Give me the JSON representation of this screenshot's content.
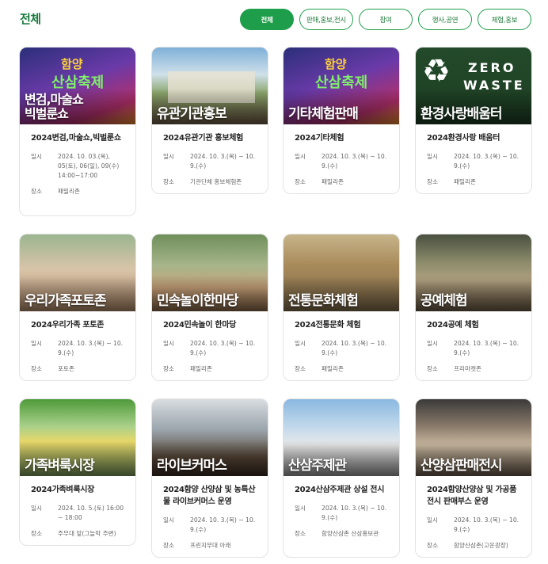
{
  "page": {
    "title": "전체"
  },
  "filters": [
    {
      "label": "전체",
      "active": true
    },
    {
      "label": "판매,홍보,전시",
      "active": false
    },
    {
      "label": "참여",
      "active": false
    },
    {
      "label": "행사,공연",
      "active": false
    },
    {
      "label": "체험,홍보",
      "active": false
    }
  ],
  "labels": {
    "date": "일시",
    "place": "장소"
  },
  "posters": {
    "festival_word_1": "함양",
    "festival_word_2": "산삼축제",
    "zero": "ZERO",
    "waste": "WASTE"
  },
  "cards": [
    {
      "overlay": "변검,마술쇼 빅벌룬쇼",
      "title": "2024변검,마술쇼,빅벌룬쇼",
      "date": "2024. 10. 03.(목), 05(토), 06(일), 09(수) 14:00~17:00",
      "place": "패밀리존"
    },
    {
      "overlay": "유관기관홍보",
      "title": "2024유관기관 홍보체험",
      "date": "2024. 10. 3.(목) ~ 10. 9.(수)",
      "place": "기관단체 홍보체험존"
    },
    {
      "overlay": "기타체험판매",
      "title": "2024기타체험",
      "date": "2024. 10. 3.(목) ~ 10. 9.(수)",
      "place": "패밀리존"
    },
    {
      "overlay": "환경사랑배움터",
      "title": "2024환경사랑 배움터",
      "date": "2024. 10. 3.(목) ~ 10. 9.(수)",
      "place": "패밀리존"
    },
    {
      "overlay": "우리가족포토존",
      "title": "2024우리가족 포토존",
      "date": "2024. 10. 3.(목) ~ 10. 9.(수)",
      "place": "포토존"
    },
    {
      "overlay": "민속놀이한마당",
      "title": "2024민속놀이 한마당",
      "date": "2024. 10. 3.(목) ~ 10. 9.(수)",
      "place": "패밀리존"
    },
    {
      "overlay": "전통문화체험",
      "title": "2024전통문화 체험",
      "date": "2024. 10. 3.(목) ~ 10. 9.(수)",
      "place": "패밀리존"
    },
    {
      "overlay": "공예체험",
      "title": "2024공예 체험",
      "date": "2024. 10. 3.(목) ~ 10. 9.(수)",
      "place": "프리마켓존"
    },
    {
      "overlay": "가족벼룩시장",
      "title": "2024가족벼룩시장",
      "date": "2024. 10. 5.(토) 16:00 ~ 18:00",
      "place": "주무대 앞(그늘막 주변)"
    },
    {
      "overlay": "라이브커머스",
      "title": "2024함양 산양삼 및 농특산물 라이브커머스 운영",
      "date": "2024. 10. 3.(목) ~ 10. 9.(수)",
      "place": "프린지무대 아래"
    },
    {
      "overlay": "산삼주제관",
      "title": "2024산삼주제관 상설 전시",
      "date": "2024. 10. 3.(목) ~ 10. 9.(수)",
      "place": "함양산삼촌 산삼홍보관"
    },
    {
      "overlay": "산양삼판매전시",
      "title": "2024함양산양삼 및 가공품 전시 판매부스 운영",
      "date": "2024. 10. 3.(목) ~ 10. 9.(수)",
      "place": "함양산삼촌(고운광장)"
    }
  ]
}
